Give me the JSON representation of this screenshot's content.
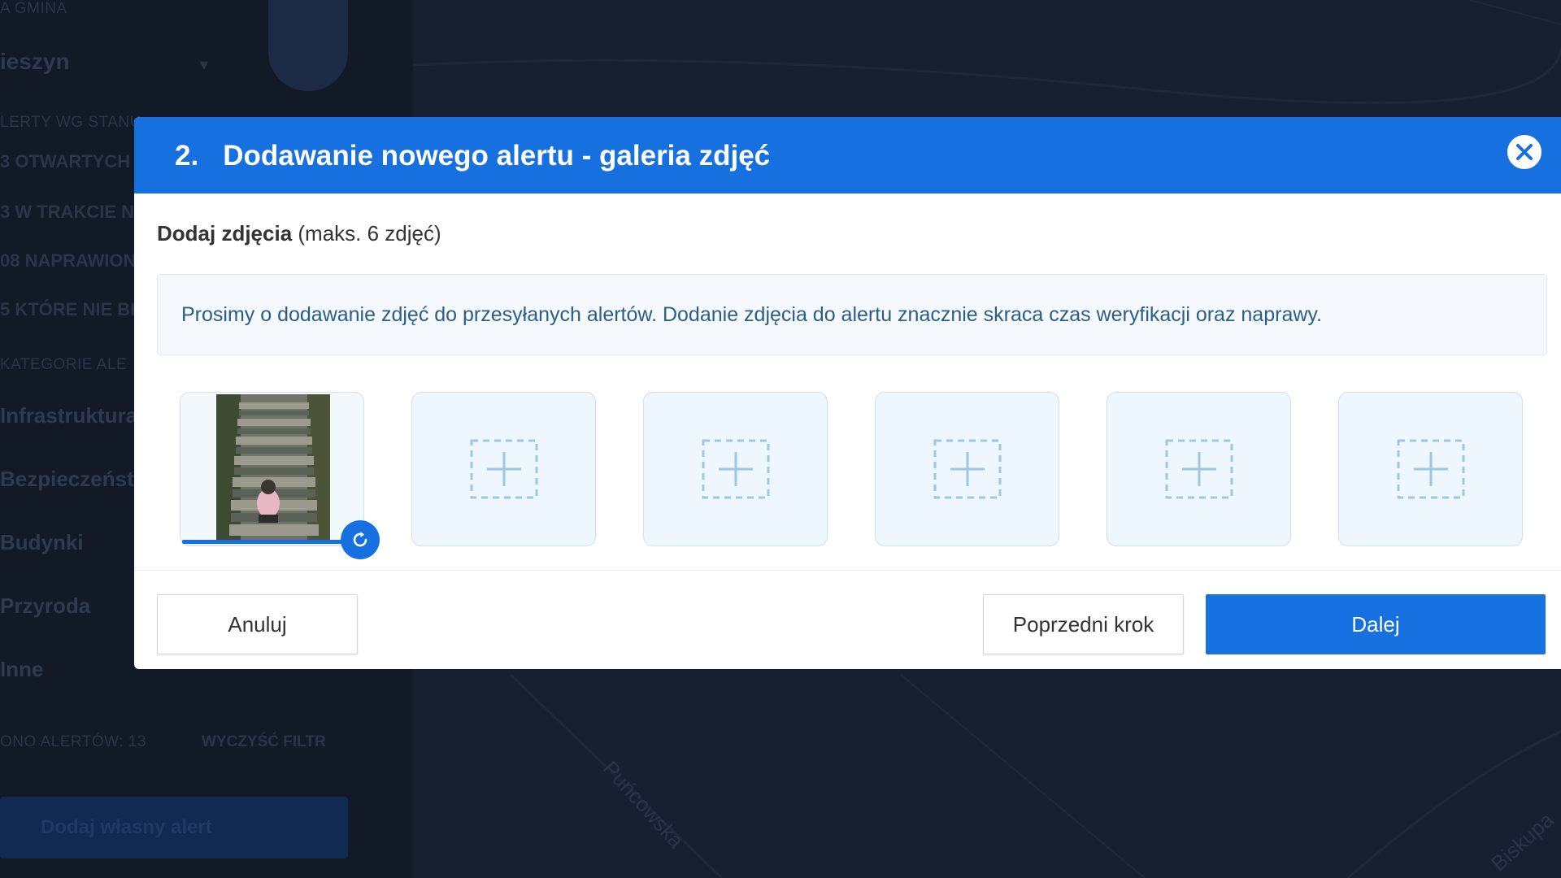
{
  "background": {
    "sidebar": {
      "gmina_label": "A GMINA",
      "city": "ieszyn",
      "status_header": "LERTY WG STANU",
      "statuses": [
        "3 OTWARTYCH",
        "3 W TRAKCIE NA",
        "08 NAPRAWIONY",
        "5 KTÓRE NIE BE"
      ],
      "categories_header": "KATEGORIE ALE",
      "categories": [
        "Infrastruktura",
        "Bezpieczeńst",
        "Budynki",
        "Przyroda",
        "Inne"
      ],
      "found_alerts": "ONO ALERTÓW: 13",
      "clear_filter": "WYCZYŚĆ FILTR",
      "add_own_alert": "Dodaj własny alert"
    },
    "map": {
      "street_1": "Puńcowska",
      "street_2": "Biskupa"
    }
  },
  "modal": {
    "step_number": "2.",
    "title": "Dodawanie nowego alertu - galeria zdjęć",
    "close_icon": "close-icon",
    "section_title_strong": "Dodaj zdjęcia",
    "section_title_note": "(maks. 6 zdjęć)",
    "info_text": "Prosimy o dodawanie zdjęć do przesyłanych alertów. Dodanie zdjęcia do alertu znacznie skraca czas weryfikacji oraz naprawy.",
    "photo_slots": [
      {
        "state": "uploaded",
        "upload_progress": 1.0,
        "icon": "refresh-icon"
      },
      {
        "state": "empty",
        "icon": "add-photo-icon"
      },
      {
        "state": "empty",
        "icon": "add-photo-icon"
      },
      {
        "state": "empty",
        "icon": "add-photo-icon"
      },
      {
        "state": "empty",
        "icon": "add-photo-icon"
      },
      {
        "state": "empty",
        "icon": "add-photo-icon"
      }
    ],
    "buttons": {
      "cancel": "Anuluj",
      "previous": "Poprzedni krok",
      "next": "Dalej"
    }
  },
  "colors": {
    "primary": "#1670e0",
    "info_text": "#2a5e8a",
    "overlay_bg": "#1b2333"
  }
}
